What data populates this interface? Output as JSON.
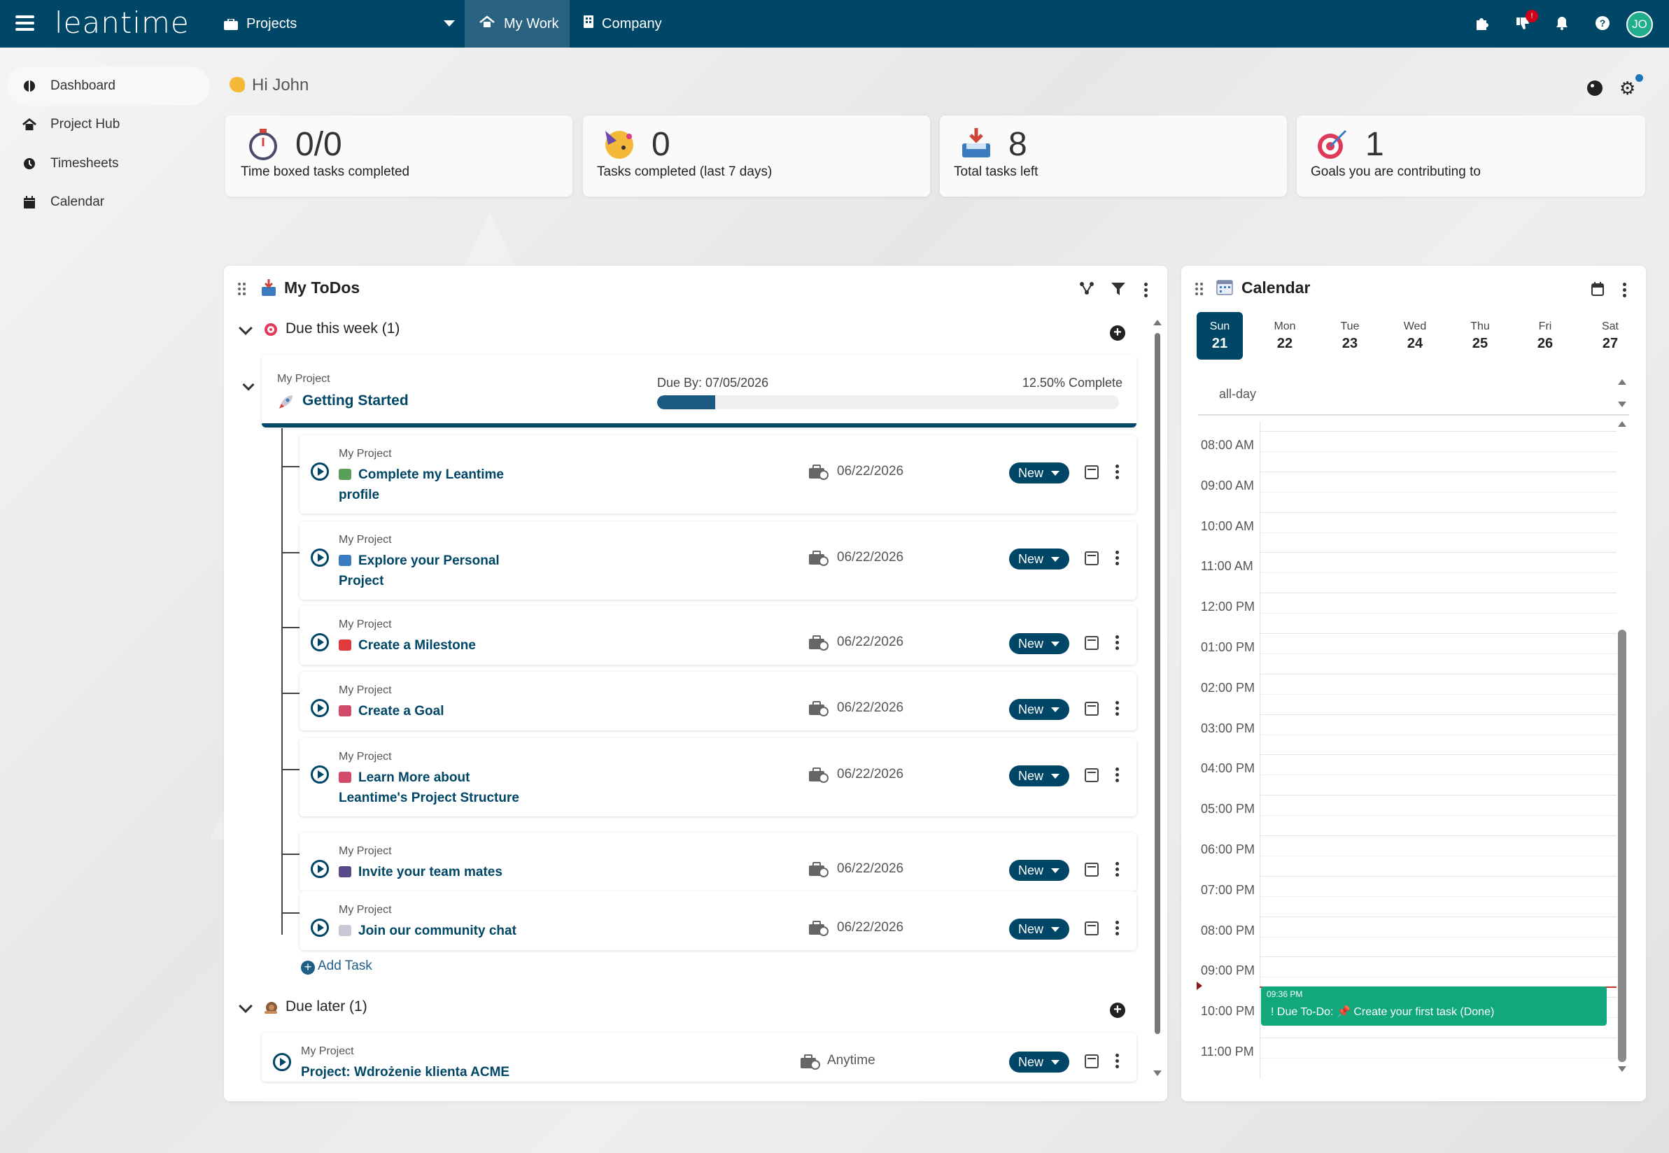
{
  "app": {
    "logo": "leantime"
  },
  "topnav": {
    "projects": "Projects",
    "my_work": "My Work",
    "company": "Company",
    "user_initials": "JO",
    "notification_count": "!"
  },
  "sidebar": {
    "items": [
      {
        "label": "Dashboard",
        "icon": "dashboard-icon",
        "active": true
      },
      {
        "label": "Project Hub",
        "icon": "project-hub-icon"
      },
      {
        "label": "Timesheets",
        "icon": "timesheets-icon"
      },
      {
        "label": "Calendar",
        "icon": "calendar-icon"
      }
    ]
  },
  "greeting": "Hi John",
  "stats": [
    {
      "value": "0/0",
      "caption": "Time boxed tasks completed",
      "icon": "stopwatch-icon"
    },
    {
      "value": "0",
      "caption": "Tasks completed (last 7 days)",
      "icon": "party-face-icon"
    },
    {
      "value": "8",
      "caption": "Total tasks left",
      "icon": "inbox-icon"
    },
    {
      "value": "1",
      "caption": "Goals you are contributing to",
      "icon": "target-icon"
    }
  ],
  "todos": {
    "title": "My ToDos",
    "section_this_week": "Due this week (1)",
    "section_later": "Due later (1)",
    "milestone": {
      "project": "My Project",
      "name": "Getting Started",
      "due": "Due By: 07/05/2026",
      "percent_label": "12.50% Complete",
      "percent": 12.5
    },
    "tasks": [
      {
        "project": "My Project",
        "name": "Complete my Leantime profile",
        "date": "06/22/2026",
        "status": "New",
        "icon_color": "#5aa05a"
      },
      {
        "project": "My Project",
        "name": "Explore your Personal Project",
        "date": "06/22/2026",
        "status": "New",
        "icon_color": "#3b7bbf"
      },
      {
        "project": "My Project",
        "name": "Create a Milestone",
        "date": "06/22/2026",
        "status": "New",
        "icon_color": "#e03a3a"
      },
      {
        "project": "My Project",
        "name": "Create a Goal",
        "date": "06/22/2026",
        "status": "New",
        "icon_color": "#d44b6a"
      },
      {
        "project": "My Project",
        "name": "Learn More about Leantime's Project Structure",
        "date": "06/22/2026",
        "status": "New",
        "icon_color": "#d44b6a"
      },
      {
        "project": "My Project",
        "name": "Invite your team mates",
        "date": "06/22/2026",
        "status": "New",
        "icon_color": "#5a4a8a"
      },
      {
        "project": "My Project",
        "name": "Join our community chat",
        "date": "06/22/2026",
        "status": "New",
        "icon_color": "#c9c9d6"
      }
    ],
    "add_task": "Add Task",
    "later_task": {
      "project": "My Project",
      "name": "Project: Wdrożenie klienta ACME",
      "date": "Anytime",
      "status": "New"
    }
  },
  "calendar": {
    "title": "Calendar",
    "days": [
      {
        "name": "Sun",
        "date": "21",
        "today": true
      },
      {
        "name": "Mon",
        "date": "22"
      },
      {
        "name": "Tue",
        "date": "23"
      },
      {
        "name": "Wed",
        "date": "24"
      },
      {
        "name": "Thu",
        "date": "25"
      },
      {
        "name": "Fri",
        "date": "26"
      },
      {
        "name": "Sat",
        "date": "27"
      }
    ],
    "allday": "all-day",
    "times": [
      "08:00 AM",
      "09:00 AM",
      "10:00 AM",
      "11:00 AM",
      "12:00 PM",
      "01:00 PM",
      "02:00 PM",
      "03:00 PM",
      "04:00 PM",
      "05:00 PM",
      "06:00 PM",
      "07:00 PM",
      "08:00 PM",
      "09:00 PM",
      "10:00 PM",
      "11:00 PM"
    ],
    "event": {
      "time": "09:36 PM",
      "text": "!  Due To-Do: 📌 Create your first task (Done)"
    }
  },
  "colors": {
    "brand": "#004666",
    "accent": "#11a87c"
  }
}
